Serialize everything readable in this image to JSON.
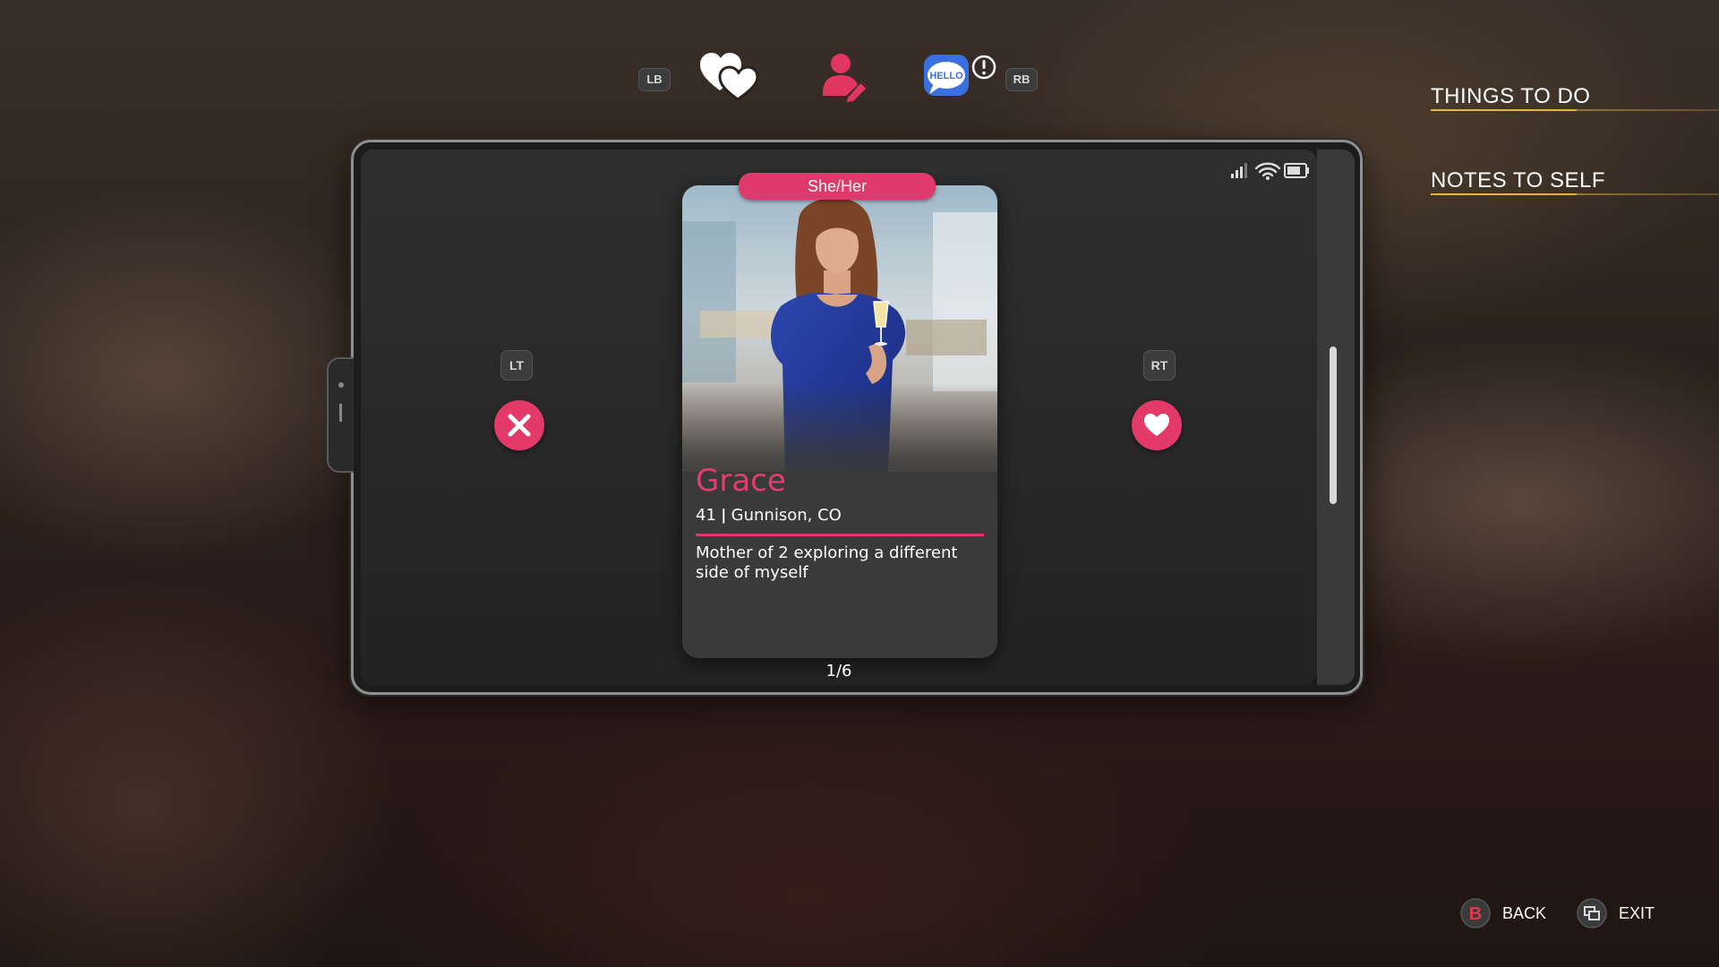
{
  "top_nav": {
    "lb_hint": "LB",
    "rb_hint": "RB",
    "chat_icon_text": "HELLO",
    "alert_symbol": "!"
  },
  "side_menu": {
    "items": [
      {
        "label": "THINGS TO DO"
      },
      {
        "label": "NOTES TO SELF"
      }
    ]
  },
  "profile": {
    "pronouns": "She/Her",
    "name": "Grace",
    "age_location": "41 ǀ Gunnison, CO",
    "bio": "Mother of 2 exploring a different side of myself"
  },
  "swipe": {
    "reject_hint": "LT",
    "like_hint": "RT"
  },
  "pager": "1/6",
  "controls": {
    "back_label": "BACK",
    "back_glyph": "B",
    "exit_label": "EXIT"
  },
  "colors": {
    "accent_pink": "#e23d6e",
    "menu_underline": "#e6b54a",
    "chat_blue": "#3a6fe0"
  },
  "icons": [
    "hearts-icon",
    "profile-edit-icon",
    "chat-hello-icon",
    "alert-icon",
    "signal-icon",
    "wifi-icon",
    "battery-icon",
    "close-icon",
    "heart-icon",
    "b-button-icon",
    "view-button-icon"
  ]
}
